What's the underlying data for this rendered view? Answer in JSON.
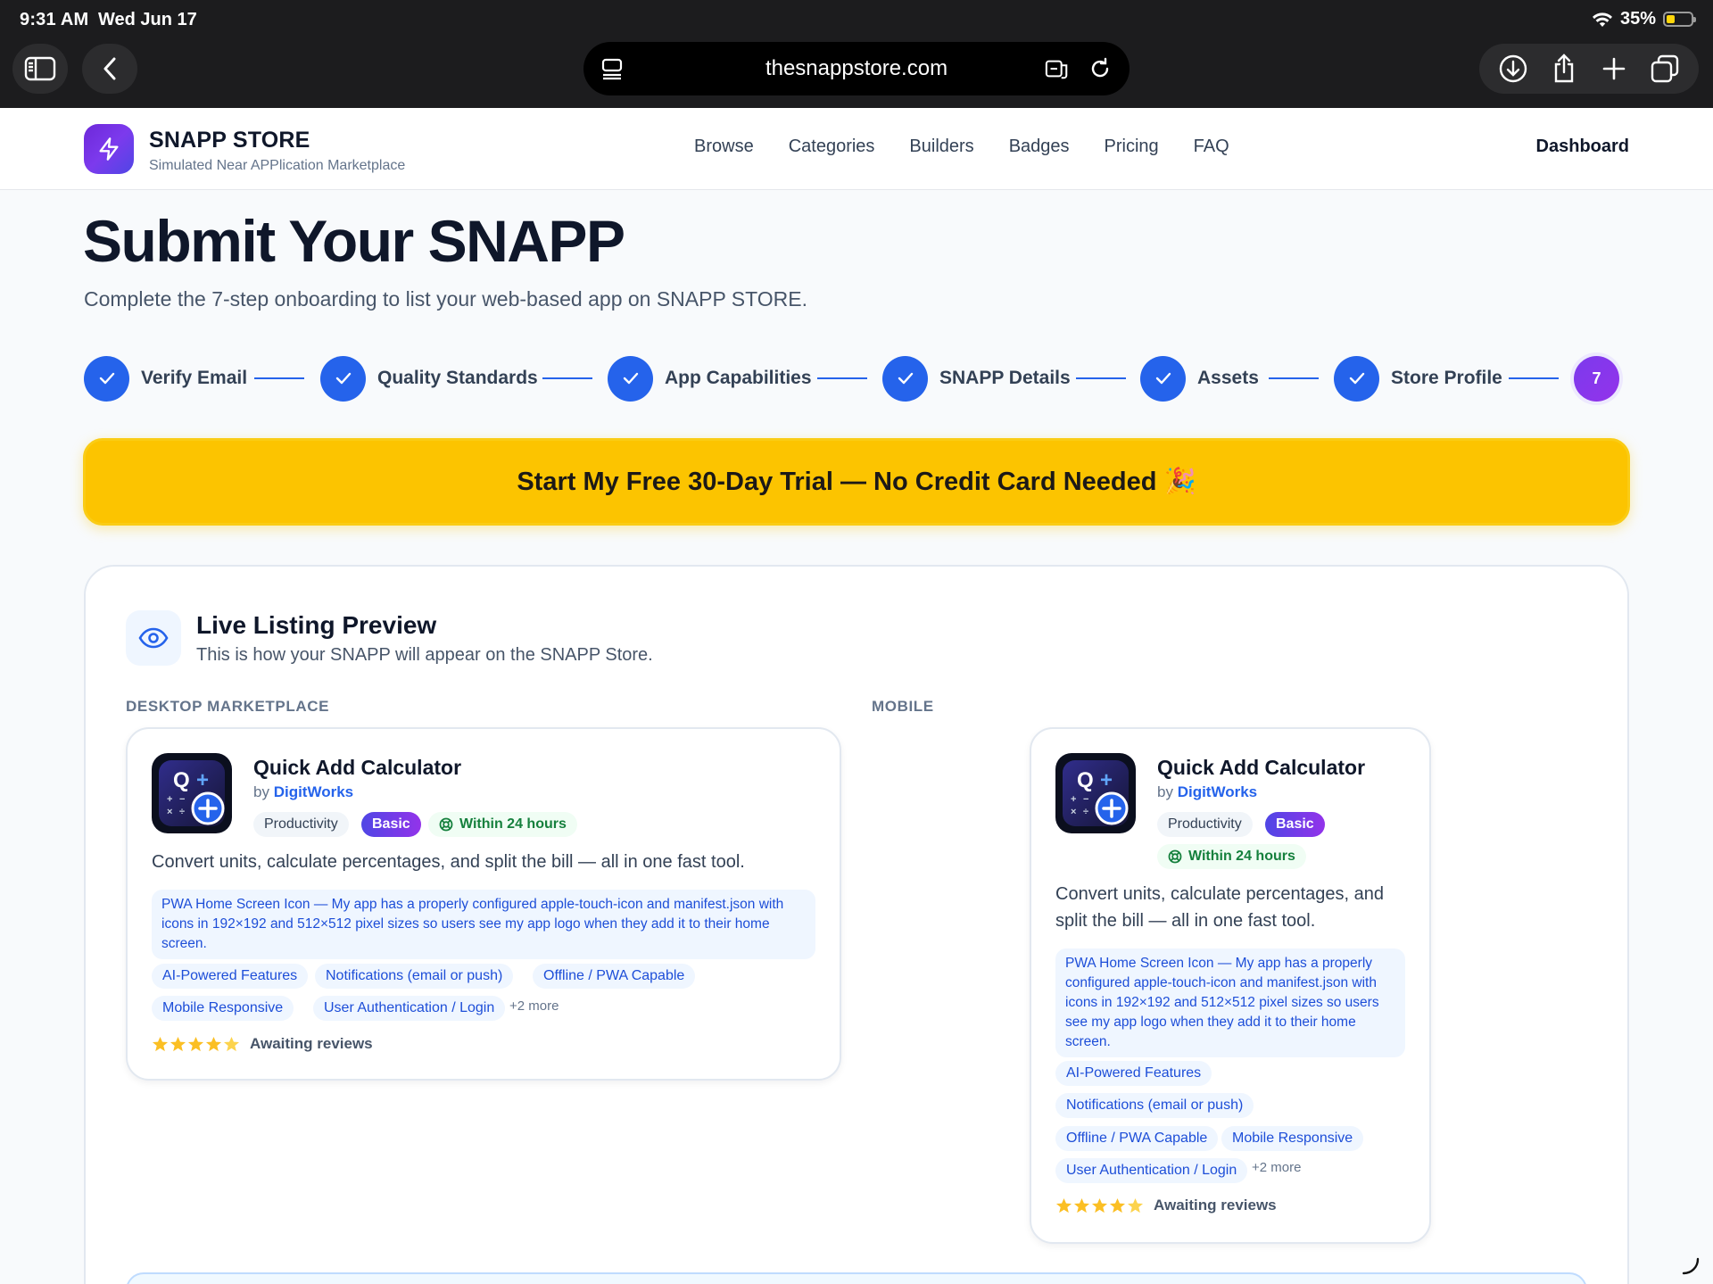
{
  "status_bar": {
    "time": "9:31 AM",
    "date": "Wed Jun 17",
    "battery": "35%",
    "battery_level": 0.35,
    "wifi_icon": "wifi-icon"
  },
  "browser": {
    "url": "thesnappstore.com",
    "icons": [
      "sidebar-icon",
      "back-icon",
      "tab-overview-icon",
      "translate-icon",
      "reload-icon",
      "download-icon",
      "share-icon",
      "plus-icon",
      "tabs-icon"
    ]
  },
  "site": {
    "brand_name": "SNAPP STORE",
    "brand_tagline": "Simulated Near APPlication Marketplace",
    "nav": [
      "Browse",
      "Categories",
      "Builders",
      "Badges",
      "Pricing",
      "FAQ"
    ],
    "dashboard": "Dashboard",
    "accent": "#7c3aed",
    "primary": "#2563eb"
  },
  "page": {
    "title": "Submit Your SNAPP",
    "subtitle": "Complete the 7-step onboarding to list your web-based app on SNAPP STORE.",
    "steps": [
      {
        "label": "Verify Email",
        "status": "done"
      },
      {
        "label": "Quality Standards",
        "status": "done"
      },
      {
        "label": "App Capabilities",
        "status": "done"
      },
      {
        "label": "SNAPP Details",
        "status": "done"
      },
      {
        "label": "Assets",
        "status": "done"
      },
      {
        "label": "Store Profile",
        "status": "done"
      },
      {
        "number": "7",
        "status": "current"
      }
    ],
    "cta": "Start My Free 30-Day Trial — No Credit Card Needed 🎉",
    "cta_color": "#fcc400"
  },
  "preview": {
    "title": "Live Listing Preview",
    "subtitle": "This is how your SNAPP will appear on the SNAPP Store.",
    "desktop_label": "DESKTOP MARKETPLACE",
    "mobile_label": "MOBILE",
    "app": {
      "name": "Quick Add Calculator",
      "by": "by",
      "developer": "DigitWorks",
      "category": "Productivity",
      "tier": "Basic",
      "response": "Within 24 hours",
      "description": "Convert units, calculate percentages, and split the bill — all in one fast tool.",
      "note": "PWA Home Screen Icon — My app has a properly configured apple-touch-icon and manifest.json with icons in 192×192 and 512×512 pixel sizes so users see my app logo when they add it to their home screen.",
      "features": [
        "AI-Powered Features",
        "Notifications (email or push)",
        "Offline / PWA Capable",
        "Mobile Responsive",
        "User Authentication / Login"
      ],
      "more": "+2 more",
      "rating_stars": 5,
      "reviews": "Awaiting reviews",
      "icon_letter": "Q"
    }
  }
}
